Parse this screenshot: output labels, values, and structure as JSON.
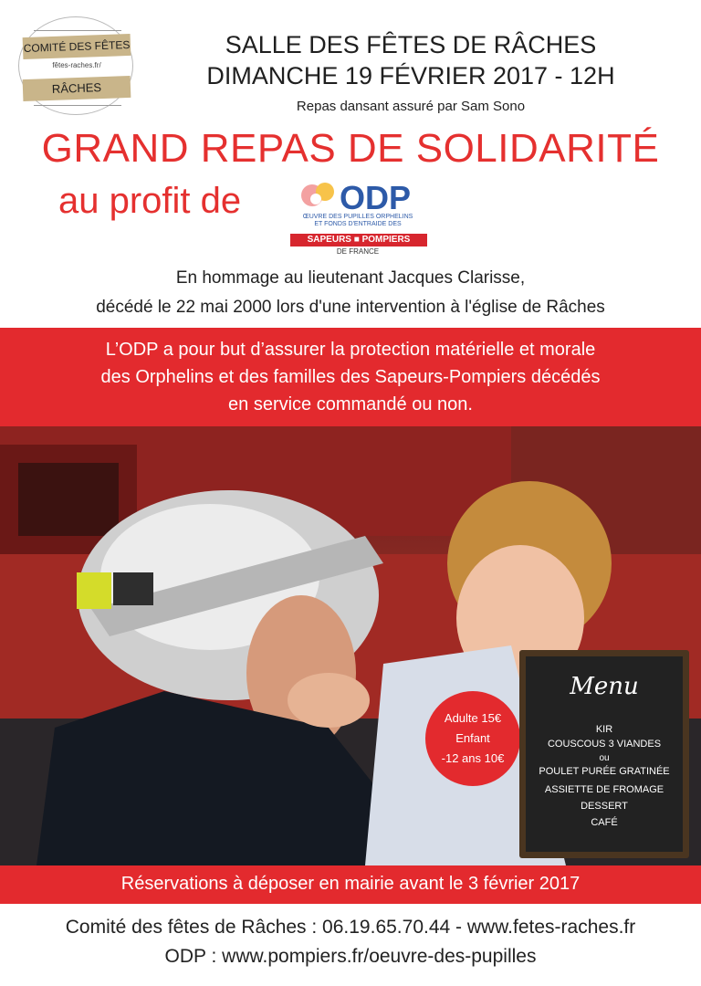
{
  "logo": {
    "top": "COMITÉ DES FÊTES",
    "url": "fêtes-raches.fr/",
    "bottom": "RÂCHES"
  },
  "header": {
    "venue": "SALLE DES FÊTES DE RÂCHES",
    "date": "DIMANCHE 19 FÉVRIER 2017 - 12H",
    "dj": "Repas dansant assuré par Sam Sono"
  },
  "title": "GRAND REPAS  DE SOLIDARITÉ",
  "profit": "au profit de",
  "odp": {
    "acronym": "ODP",
    "sub1": "ŒUVRE DES PUPILLES ORPHELINS",
    "sub2": "ET FONDS D'ENTRAIDE DES",
    "band": "SAPEURS ■ POMPIERS",
    "country": "DE FRANCE"
  },
  "tribute": {
    "line1": "En hommage au lieutenant Jacques Clarisse,",
    "line2": "décédé le 22 mai 2000 lors d'une intervention à l'église de Râches"
  },
  "mission": {
    "line1": "L’ODP a pour but d’assurer la protection matérielle et morale",
    "line2": "des Orphelins et des familles des Sapeurs-Pompiers décédés",
    "line3": "en service commandé ou non."
  },
  "price": {
    "line1": "Adulte 15€",
    "line2": "Enfant",
    "line3": "-12 ans  10€"
  },
  "menu": {
    "title": "Menu",
    "items": [
      "KIR",
      "COUSCOUS 3 VIANDES",
      "ou",
      "POULET PURÉE GRATINÉE",
      "ASSIETTE DE FROMAGE",
      "DESSERT",
      "CAFÉ"
    ]
  },
  "reservation": "Réservations à déposer en mairie avant le 3 février 2017",
  "footer": {
    "line1": "Comité des fêtes de Râches : 06.19.65.70.44 - www.fetes-raches.fr",
    "line2": "ODP : www.pompiers.fr/oeuvre-des-pupilles"
  },
  "colors": {
    "accent_red": "#e32a2e",
    "title_red": "#e5302f",
    "logo_band": "#c9b58a",
    "odp_blue": "#2d5aa8"
  }
}
